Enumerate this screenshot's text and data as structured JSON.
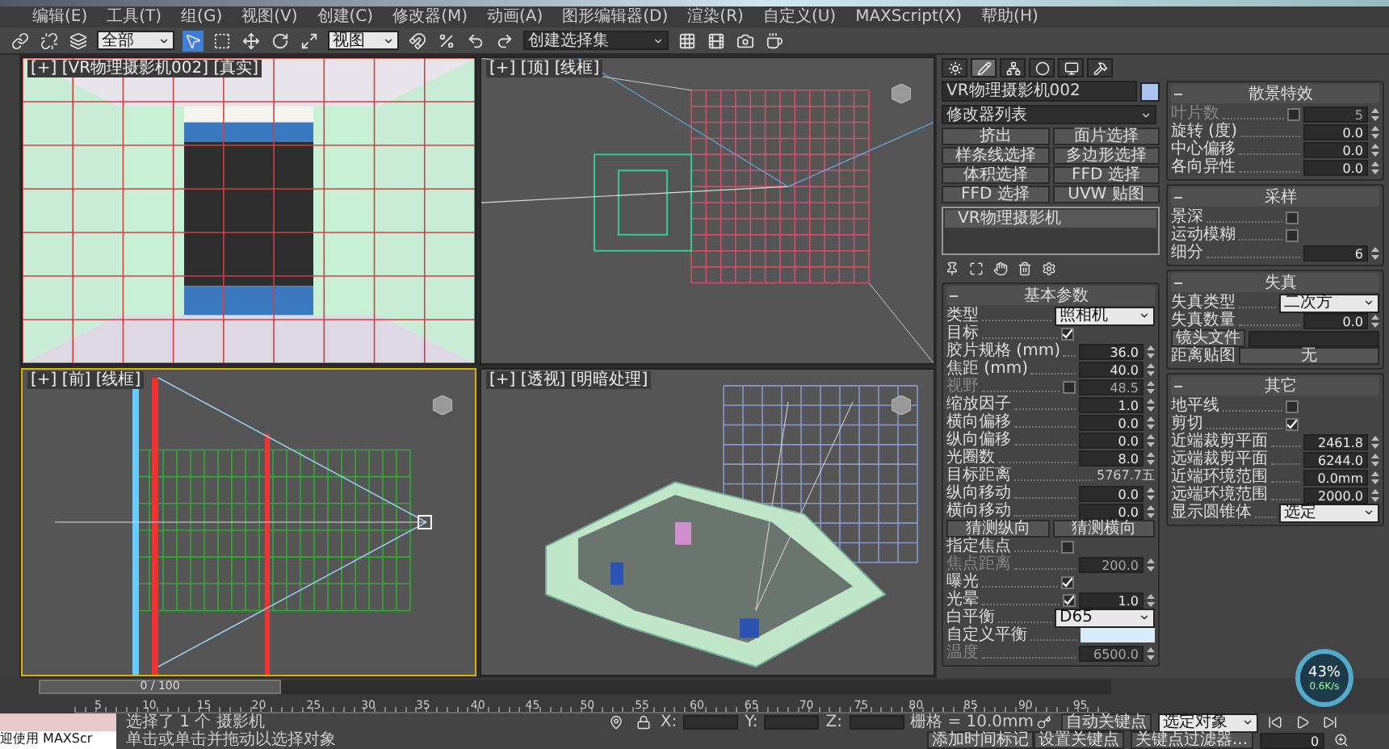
{
  "menu": [
    "编辑(E)",
    "工具(T)",
    "组(G)",
    "视图(V)",
    "创建(C)",
    "修改器(M)",
    "动画(A)",
    "图形编辑器(D)",
    "渲染(R)",
    "自定义(U)",
    "MAXScript(X)",
    "帮助(H)"
  ],
  "toolbar": {
    "selection_filter": "全部",
    "coordinate_system": "视图",
    "selection_set": "创建选择集"
  },
  "viewports": [
    {
      "label": "[+] [VR物理摄影机002] [真实]",
      "kind": "camera",
      "selected": false
    },
    {
      "label": "[+] [顶] [线框]",
      "kind": "top",
      "selected": false
    },
    {
      "label": "[+] [前] [线框]",
      "kind": "front",
      "selected": true
    },
    {
      "label": "[+] [透视] [明暗处理]",
      "kind": "perspective",
      "selected": false
    }
  ],
  "command_panel": {
    "tabs": [
      {
        "selected": false
      },
      {
        "selected": true
      },
      {
        "selected": false
      },
      {
        "selected": false
      },
      {
        "selected": false
      },
      {
        "selected": false
      }
    ],
    "object_name": "VR物理摄影机002",
    "modifier_list": "修改器列表",
    "modifier_buttons": [
      "挤出",
      "面片选择",
      "样条线选择",
      "多边形选择",
      "体积选择",
      "FFD 选择",
      "FFD 选择",
      "UVW 贴图"
    ],
    "stack": [
      "VR物理摄影机"
    ],
    "left_rollouts": [
      {
        "title": "基本参数",
        "rows": [
          {
            "kind": "dropdown",
            "label": "类型",
            "value": "照相机"
          },
          {
            "kind": "check",
            "label": "目标",
            "checked": true
          },
          {
            "kind": "spinner",
            "label": "胶片规格 (mm)",
            "value": "36.0"
          },
          {
            "kind": "spinner",
            "label": "焦距 (mm)",
            "value": "40.0"
          },
          {
            "kind": "check_spinner",
            "label": "视野",
            "checked": false,
            "value": "48.5",
            "disabled": true
          },
          {
            "kind": "spinner",
            "label": "缩放因子",
            "value": "1.0"
          },
          {
            "kind": "spinner",
            "label": "横向偏移",
            "value": "0.0"
          },
          {
            "kind": "spinner",
            "label": "纵向偏移",
            "value": "0.0"
          },
          {
            "kind": "spinner",
            "label": "光圈数",
            "value": "8.0"
          },
          {
            "kind": "reading",
            "label": "目标距离",
            "value": "5767.7五"
          },
          {
            "kind": "spinner",
            "label": "纵向移动",
            "value": "0.0"
          },
          {
            "kind": "spinner",
            "label": "横向移动",
            "value": "0.0"
          },
          {
            "kind": "buttons",
            "buttons": [
              "猜测纵向",
              "猜测横向"
            ]
          },
          {
            "kind": "check",
            "label": "指定焦点",
            "checked": false
          },
          {
            "kind": "spinner",
            "label": "焦点距离",
            "value": "200.0",
            "disabled": true
          },
          {
            "kind": "check",
            "label": "曝光",
            "checked": true
          },
          {
            "kind": "check_spinner",
            "label": "光晕",
            "checked": true,
            "value": "1.0",
            "disabled": false
          },
          {
            "kind": "dropdown",
            "label": "白平衡",
            "value": "D65"
          },
          {
            "kind": "color",
            "label": "自定义平衡",
            "color": "#d8ecfa"
          },
          {
            "kind": "spinner",
            "label": "温度",
            "value": "6500.0",
            "disabled": true
          }
        ]
      }
    ],
    "right_rollouts": [
      {
        "title": "散景特效",
        "rows": [
          {
            "kind": "check_spinner",
            "label": "叶片数",
            "checked": false,
            "value": "5",
            "disabled": true
          },
          {
            "kind": "spinner",
            "label": "旋转 (度)",
            "value": "0.0"
          },
          {
            "kind": "spinner",
            "label": "中心偏移",
            "value": "0.0"
          },
          {
            "kind": "spinner",
            "label": "各向异性",
            "value": "0.0"
          }
        ]
      },
      {
        "title": "采样",
        "rows": [
          {
            "kind": "check",
            "label": "景深",
            "checked": false
          },
          {
            "kind": "check",
            "label": "运动模糊",
            "checked": false
          },
          {
            "kind": "spinner",
            "label": "细分",
            "value": "6"
          }
        ]
      },
      {
        "title": "失真",
        "rows": [
          {
            "kind": "dropdown",
            "label": "失真类型",
            "value": "二次方"
          },
          {
            "kind": "spinner",
            "label": "失真数量",
            "value": "0.0"
          },
          {
            "kind": "button_field",
            "button": "镜头文件"
          },
          {
            "kind": "map",
            "label": "距离贴图",
            "value": "无"
          }
        ]
      },
      {
        "title": "其它",
        "rows": [
          {
            "kind": "check",
            "label": "地平线",
            "checked": false
          },
          {
            "kind": "check",
            "label": "剪切",
            "checked": true
          },
          {
            "kind": "spinner",
            "label": "近端裁剪平面",
            "value": "2461.8"
          },
          {
            "kind": "spinner",
            "label": "远端裁剪平面",
            "value": "6244.0"
          },
          {
            "kind": "spinner",
            "label": "近端环境范围",
            "value": "0.0mm"
          },
          {
            "kind": "spinner",
            "label": "远端环境范围",
            "value": "2000.0"
          },
          {
            "kind": "dropdown",
            "label": "显示圆锥体",
            "value": "选定"
          }
        ]
      }
    ]
  },
  "timeline": {
    "slider": "0 / 100",
    "level": 0,
    "ticks": [
      "5",
      "10",
      "15",
      "20",
      "25",
      "30",
      "35",
      "40",
      "45",
      "50",
      "55",
      "60",
      "65",
      "70",
      "75",
      "80",
      "85",
      "90",
      "95"
    ]
  },
  "status": {
    "script_listener": "迎使用 MAXScr",
    "selection": "选择了 1 个 摄影机",
    "prompt": "单击或单击并拖动以选择对象",
    "x": "X:",
    "y": "Y:",
    "z": "Z:",
    "grid": "栅格 = 10.0mm",
    "time_tag": "添加时间标记",
    "auto_key": "自动关键点",
    "key_mode": "选定对象",
    "set_key": "设置关键点",
    "key_filters": "关键点过滤器...",
    "frame": "0"
  },
  "net_meter": {
    "percent": "43%",
    "speed": "0.6K/s"
  }
}
